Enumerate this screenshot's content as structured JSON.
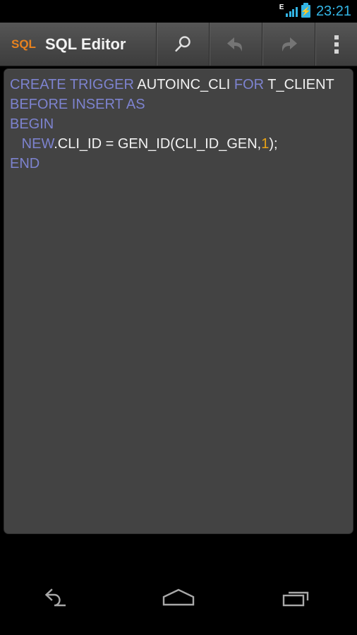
{
  "status_bar": {
    "network_type": "E",
    "network_icon": "signal-bars-icon",
    "battery_icon": "battery-charging-icon",
    "battery_bolt": "⚡",
    "clock": "23:21"
  },
  "action_bar": {
    "logo_text": "SQL",
    "logo_color": "#e8821e",
    "title": "SQL Editor",
    "buttons": [
      {
        "name": "search-button",
        "icon": "search-icon",
        "enabled": true
      },
      {
        "name": "undo-button",
        "icon": "undo-icon",
        "enabled": false
      },
      {
        "name": "redo-button",
        "icon": "redo-icon",
        "enabled": false
      },
      {
        "name": "overflow-menu-button",
        "icon": "overflow-menu-icon",
        "enabled": true
      }
    ]
  },
  "editor": {
    "background_color": "#434343",
    "keyword_color": "#7d83cf",
    "identifier_color": "#f2f2f2",
    "number_color": "#e8a317",
    "lines": [
      {
        "tokens": [
          {
            "t": "CREATE TRIGGER ",
            "k": "kw"
          },
          {
            "t": "AUTOINC_CLI ",
            "k": "id"
          },
          {
            "t": "FOR ",
            "k": "kw"
          },
          {
            "t": "T_CLIENT",
            "k": "id"
          }
        ]
      },
      {
        "tokens": [
          {
            "t": "BEFORE INSERT AS",
            "k": "kw"
          }
        ]
      },
      {
        "tokens": [
          {
            "t": "BEGIN",
            "k": "kw"
          }
        ]
      },
      {
        "tokens": [
          {
            "t": "   NEW",
            "k": "kw"
          },
          {
            "t": ".CLI_ID = GEN_ID(CLI_ID_GEN,",
            "k": "id"
          },
          {
            "t": "1",
            "k": "num"
          },
          {
            "t": ");",
            "k": "id"
          }
        ]
      },
      {
        "tokens": [
          {
            "t": "END",
            "k": "kw"
          }
        ]
      }
    ],
    "plain_text": "CREATE TRIGGER AUTOINC_CLI FOR T_CLIENT\nBEFORE INSERT AS\nBEGIN\n   NEW.CLI_ID = GEN_ID(CLI_ID_GEN,1);\nEND"
  },
  "nav_bar": {
    "buttons": [
      {
        "name": "nav-back-button",
        "icon": "back-arrow-icon"
      },
      {
        "name": "nav-home-button",
        "icon": "home-pentagon-icon"
      },
      {
        "name": "nav-recents-button",
        "icon": "recents-squares-icon"
      }
    ]
  }
}
